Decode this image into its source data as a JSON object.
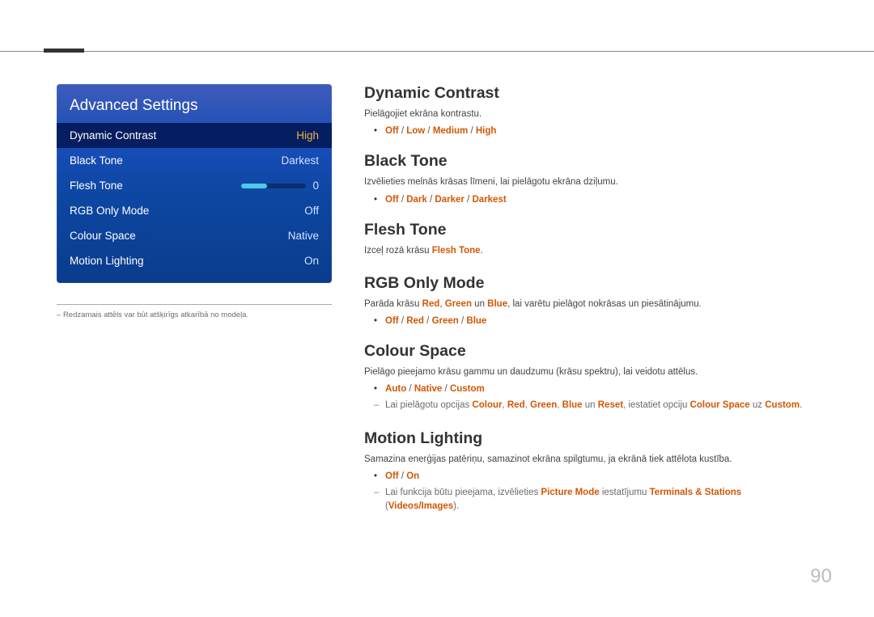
{
  "page_number": "90",
  "osd": {
    "title": "Advanced Settings",
    "rows": [
      {
        "label": "Dynamic Contrast",
        "value": "High",
        "selected": true
      },
      {
        "label": "Black Tone",
        "value": "Darkest",
        "selected": false
      },
      {
        "label": "Flesh Tone",
        "value": "0",
        "selected": false,
        "slider": true
      },
      {
        "label": "RGB Only Mode",
        "value": "Off",
        "selected": false
      },
      {
        "label": "Colour Space",
        "value": "Native",
        "selected": false
      },
      {
        "label": "Motion Lighting",
        "value": "On",
        "selected": false
      }
    ]
  },
  "left_footnote": "Redzamais attēls var būt atšķirīgs atkarībā no modeļa.",
  "sections": {
    "dynamic_contrast": {
      "heading": "Dynamic Contrast",
      "desc": "Pielāgojiet ekrāna kontrastu.",
      "opts": [
        "Off",
        "Low",
        "Medium",
        "High"
      ]
    },
    "black_tone": {
      "heading": "Black Tone",
      "desc": "Izvēlieties melnās krāsas līmeni, lai pielāgotu ekrāna dziļumu.",
      "opts": [
        "Off",
        "Dark",
        "Darker",
        "Darkest"
      ]
    },
    "flesh_tone": {
      "heading": "Flesh Tone",
      "desc_pre": "Izceļ rozā krāsu ",
      "desc_em": "Flesh Tone",
      "desc_post": "."
    },
    "rgb_only": {
      "heading": "RGB Only Mode",
      "desc_pre": "Parāda krāsu ",
      "r": "Red",
      "g": "Green",
      "b": "Blue",
      "desc_mid": ", ",
      "desc_and": " un ",
      "desc_post": ", lai varētu pielāgot nokrāsas un piesātinājumu.",
      "opts": [
        "Off",
        "Red",
        "Green",
        "Blue"
      ]
    },
    "colour_space": {
      "heading": "Colour Space",
      "desc": "Pielāgo pieejamo krāsu gammu un daudzumu (krāsu spektru), lai veidotu attēlus.",
      "opts": [
        "Auto",
        "Native",
        "Custom"
      ],
      "note_pre": "Lai pielāgotu opcijas ",
      "note_items": [
        "Colour",
        "Red",
        "Green",
        "Blue"
      ],
      "note_and": " un ",
      "note_reset": "Reset",
      "note_mid": ", iestatiet opciju ",
      "note_cs": "Colour Space",
      "note_to": " uz ",
      "note_custom": "Custom",
      "note_end": "."
    },
    "motion_lighting": {
      "heading": "Motion Lighting",
      "desc": "Samazina enerģijas patēriņu, samazinot ekrāna spilgtumu, ja ekrānā tiek attēlota kustība.",
      "opts": [
        "Off",
        "On"
      ],
      "note_pre": "Lai funkcija būtu pieejama, izvēlieties ",
      "note_pm": "Picture Mode",
      "note_mid": " iestatījumu ",
      "note_ts": "Terminals & Stations",
      "note_paren_l": " (",
      "note_vi": "Videos/Images",
      "note_paren_r": ").",
      "note_end": ""
    }
  }
}
